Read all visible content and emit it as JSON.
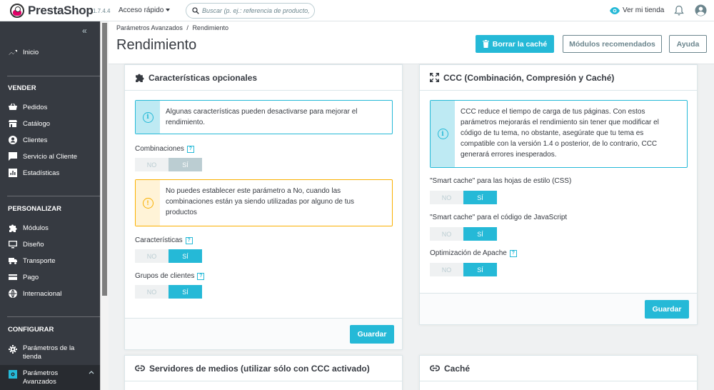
{
  "colors": {
    "accent": "#25b9d7",
    "warning": "#fab000",
    "sidebar": "#363a41",
    "sidebar_active": "#282b30"
  },
  "topbar": {
    "brand": "PrestaShop",
    "version": "1.7.4.4",
    "quick_access": "Acceso rápido",
    "search_placeholder": "Buscar (p. ej.: referencia de producto, n",
    "view_store": "Ver mi tienda"
  },
  "sidebar": {
    "collapse": "«",
    "home": "Inicio",
    "sections": {
      "sell": "VENDER",
      "customize": "PERSONALIZAR",
      "configure": "CONFIGURAR"
    },
    "sell_items": [
      "Pedidos",
      "Catálogo",
      "Clientes",
      "Servicio al Cliente",
      "Estadísticas"
    ],
    "customize_items": [
      "Módulos",
      "Diseño",
      "Transporte",
      "Pago",
      "Internacional"
    ],
    "configure_items": [
      {
        "line1": "Parámetros de la",
        "line2": "tienda"
      },
      {
        "line1": "Parámetros",
        "line2": "Avanzados"
      }
    ]
  },
  "header": {
    "breadcrumb": [
      "Parámetros Avanzados",
      "Rendimiento"
    ],
    "breadcrumb_sep": "/",
    "title": "Rendimiento",
    "clear_cache": "Borrar la caché",
    "recommended_modules": "Módulos recomendados",
    "help": "Ayuda"
  },
  "optional_features": {
    "title": "Características opcionales",
    "info": "Algunas características pueden desactivarse para mejorar el rendimiento.",
    "combinations_label": "Combinaciones",
    "warning": "No puedes establecer este parámetro a No, cuando las combinaciones están ya siendo utilizadas por alguno de tus productos",
    "features_label": "Características",
    "customer_groups_label": "Grupos de clientes",
    "save": "Guardar"
  },
  "ccc": {
    "title": "CCC (Combinación, Compresión y Caché)",
    "info": "CCC reduce el tiempo de carga de tus páginas. Con estos parámetros mejorarás el rendimiento sin tener que modificar el código de tu tema, no obstante, asegúrate que tu tema es compatible con la versión 1.4 o posterior, de lo contrario, CCC generará errores inesperados.",
    "css_label": "\"Smart cache\" para las hojas de estilo (CSS)",
    "js_label": "\"Smart cache\" para el código de JavaScript",
    "apache_label": "Optimización de Apache",
    "save": "Guardar"
  },
  "switch": {
    "no": "NO",
    "yes": "SÍ"
  },
  "help_mark": "?",
  "media_servers": {
    "title": "Servidores de medios (utilizar sólo con CCC activado)"
  },
  "cache": {
    "title": "Caché"
  }
}
